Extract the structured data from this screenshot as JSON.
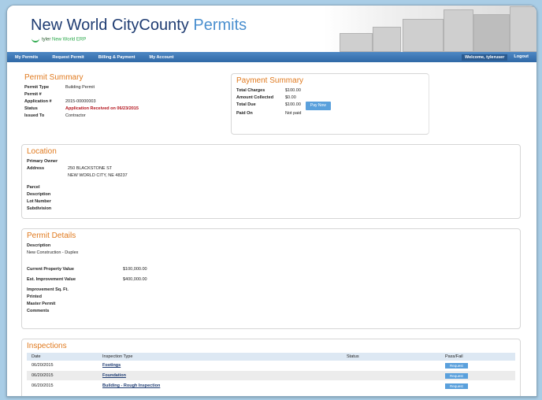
{
  "header": {
    "title_main": "New World CityCounty",
    "title_accent": "Permits",
    "logo_line1": "tyler",
    "logo_line2": "New World ERP"
  },
  "nav": {
    "items": [
      "My Permits",
      "Request Permit",
      "Billing & Payment",
      "My Account"
    ],
    "welcome": "Welcome, tyleruser",
    "logout": "Logout"
  },
  "permit_summary": {
    "title": "Permit Summary",
    "rows": [
      {
        "label": "Permit Type",
        "value": "Building Permit"
      },
      {
        "label": "Permit #",
        "value": ""
      },
      {
        "label": "Application #",
        "value": "2015-00000003"
      },
      {
        "label": "Status",
        "value": "Application Received on 06/23/2015"
      },
      {
        "label": "Issued To",
        "value": "Contractor"
      }
    ]
  },
  "payment_summary": {
    "title": "Payment Summary",
    "rows": [
      {
        "label": "Total Charges",
        "value": "$100.00"
      },
      {
        "label": "Amount Collected",
        "value": "$0.00"
      },
      {
        "label": "Total Due",
        "value": "$100.00"
      },
      {
        "label": "Paid On",
        "value": "Not paid"
      }
    ],
    "pay_button": "Pay Now"
  },
  "location": {
    "title": "Location",
    "rows": [
      {
        "label": "Primary Owner",
        "value": ""
      },
      {
        "label": "Address",
        "value": "250 BLACKSTONE ST"
      },
      {
        "label": "",
        "value": "NEW WORLD CITY, NE 48237"
      },
      {
        "label": "Parcel",
        "value": ""
      },
      {
        "label": "Description",
        "value": ""
      },
      {
        "label": "Lot Number",
        "value": ""
      },
      {
        "label": "Subdivision",
        "value": ""
      }
    ]
  },
  "permit_details": {
    "title": "Permit Details",
    "description_label": "Description",
    "description_value": "New Construction - Duplex",
    "rows": [
      {
        "label": "Current Property Value",
        "value": "$100,000.00"
      },
      {
        "label": "Est. Improvement Value",
        "value": "$400,000.00"
      },
      {
        "label": "Improvement Sq. Ft.",
        "value": ""
      },
      {
        "label": "Printed",
        "value": ""
      },
      {
        "label": "Master Permit",
        "value": ""
      },
      {
        "label": "Comments",
        "value": ""
      }
    ]
  },
  "inspections": {
    "title": "Inspections",
    "columns": [
      "Date",
      "Inspection Type",
      "Status",
      "Pass/Fail"
    ],
    "rows": [
      {
        "date": "06/20/2015",
        "type": "Footings",
        "status": "",
        "button": "Request"
      },
      {
        "date": "06/20/2015",
        "type": "Foundation",
        "status": "",
        "button": "Request"
      },
      {
        "date": "06/20/2015",
        "type": "Building - Rough Inspection",
        "status": "",
        "button": "Request"
      }
    ]
  }
}
